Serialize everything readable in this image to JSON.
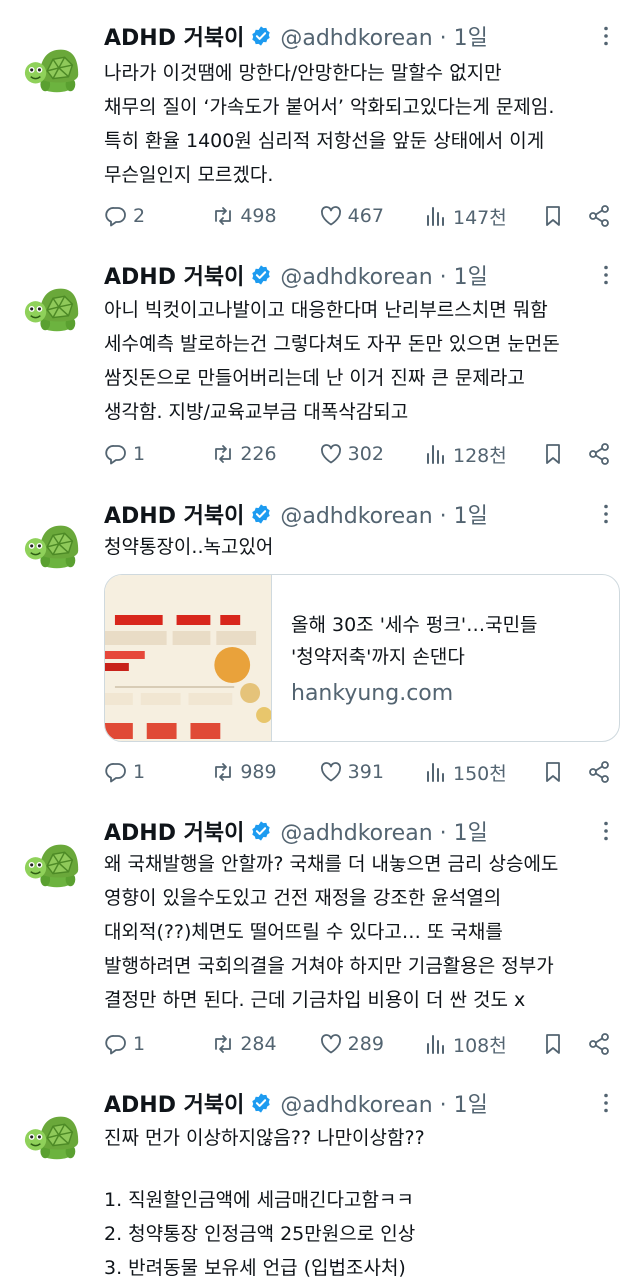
{
  "tweets": [
    {
      "name": "ADHD 거북이",
      "handle": "@adhdkorean · 1일",
      "lines": [
        "나라가 이것땜에 망한다/안망한다는 말할수 없지만",
        "채무의 질이 ‘가속도가 붙어서’ 악화되고있다는게 문제임.",
        "특히 환율 1400원 심리적 저항선을 앞둔 상태에서 이게",
        "무슨일인지 모르겠다."
      ],
      "stats": {
        "replies": "2",
        "retweets": "498",
        "likes": "467",
        "views": "147천"
      }
    },
    {
      "name": "ADHD 거북이",
      "handle": "@adhdkorean · 1일",
      "lines": [
        "아니 빅컷이고나발이고 대응한다며 난리부르스치면 뭐함",
        "세수예측 발로하는건 그렇다쳐도 자꾸 돈만 있으면 눈먼돈",
        "쌈짓돈으로 만들어버리는데 난 이거 진짜 큰 문제라고",
        "생각함. 지방/교육교부금 대폭삭감되고"
      ],
      "stats": {
        "replies": "1",
        "retweets": "226",
        "likes": "302",
        "views": "128천"
      }
    },
    {
      "name": "ADHD 거북이",
      "handle": "@adhdkorean · 1일",
      "lines": [
        "청약통장이..녹고있어"
      ],
      "card": {
        "title_lines": [
          "올해 30조 '세수 펑크'…국민들",
          "'청약저축'까지 손댄다"
        ],
        "domain": "hankyung.com"
      },
      "stats": {
        "replies": "1",
        "retweets": "989",
        "likes": "391",
        "views": "150천"
      }
    },
    {
      "name": "ADHD 거북이",
      "handle": "@adhdkorean · 1일",
      "lines": [
        "왜 국채발행을 안할까? 국채를 더 내놓으면 금리 상승에도",
        "영향이 있을수도있고 건전 재정을 강조한 윤석열의",
        "대외적(??)체면도 떨어뜨릴 수 있다고… 또 국채를",
        "발행하려면 국회의결을 거쳐야 하지만 기금활용은 정부가",
        "결정만 하면 된다. 근데 기금차입 비용이 더 싼 것도 x"
      ],
      "stats": {
        "replies": "1",
        "retweets": "284",
        "likes": "289",
        "views": "108천"
      }
    },
    {
      "name": "ADHD 거북이",
      "handle": "@adhdkorean · 1일",
      "lines": [
        "진짜 먼가 이상하지않음?? 나만이상함??"
      ],
      "list": [
        "1. 직원할인금액에 세금매긴다고함ㅋㅋ",
        "2. 청약통장 인정금액 25만원으로 인상",
        "3. 반려동물 보유세 언급 (입법조사처)"
      ]
    }
  ],
  "colors": {
    "text": "#0f1419",
    "secondary": "#536471",
    "verified": "#1d9bf0",
    "border": "#cfd9de"
  },
  "icons": [
    "turtle-avatar-icon",
    "verified-badge-icon",
    "more-icon",
    "reply-icon",
    "retweet-icon",
    "like-icon",
    "views-icon",
    "bookmark-icon",
    "share-icon"
  ]
}
